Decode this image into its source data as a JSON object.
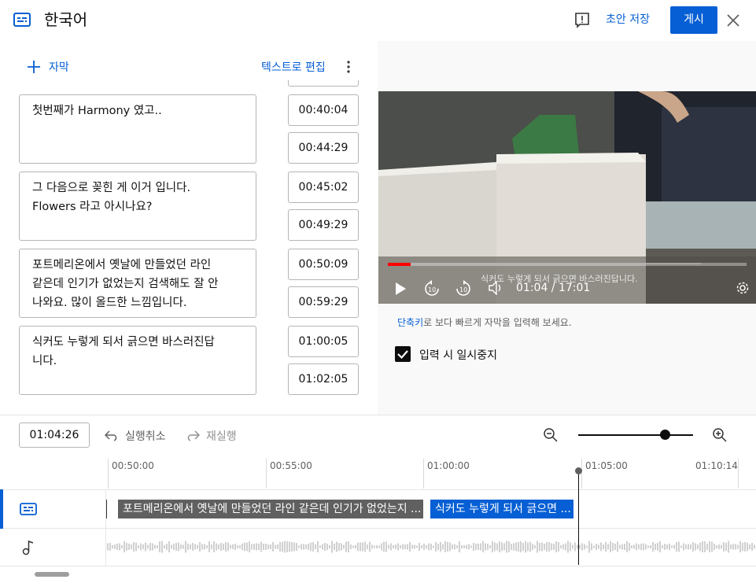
{
  "header": {
    "title": "한국어",
    "draft_label": "초안 저장",
    "publish_label": "게시"
  },
  "editor": {
    "add_subtitle_label": "자막",
    "edit_as_text_label": "텍스트로 편집",
    "cues": [
      {
        "text": "첫번째가 Harmony 였고..",
        "start": "00:40:04",
        "end": "00:44:29"
      },
      {
        "text": "그 다음으로 꽂힌 게 이거 입니다.\nFlowers 라고 아시나요?",
        "start": "00:45:02",
        "end": "00:49:29"
      },
      {
        "text": "포트메리온에서 옛날에 만들었던 라인\n같은데 인기가 없었는지 검색해도 잘 안\n나와요. 많이 올드한 느낌입니다.",
        "start": "00:50:09",
        "end": "00:59:29"
      },
      {
        "text": "식커도 누렇게 되서 긁으면 바스러진답\n니다.",
        "start": "01:00:05",
        "end": "01:02:05"
      }
    ]
  },
  "player": {
    "caption_overlay": "식커도 누렇게 되서 긁으면 바스러진답니다.",
    "time_display": "01:04 / 17:01",
    "progress_fraction": 0.063
  },
  "side": {
    "hint_link": "단축키",
    "hint_rest": "로 보다 빠르게 자막을 입력해 보세요.",
    "pause_while_typing_label": "입력 시 일시중지",
    "pause_while_typing_checked": true
  },
  "timeline": {
    "current_time": "01:04:26",
    "undo_label": "실행취소",
    "redo_label": "재실행",
    "zoom_fraction": 0.75,
    "ticks": [
      "00:50:00",
      "00:55:00",
      "01:00:00",
      "01:05:00",
      "01:10:14"
    ],
    "chips": [
      "포트메리온에서 옛날에 만들었던 라인 같은데 인기가 없었는지 ...",
      "식커도 누렇게 되서 긁으면 ..."
    ]
  },
  "colors": {
    "accent": "#065fd4",
    "chip_grey": "#606060",
    "progress_red": "#ff0000"
  }
}
